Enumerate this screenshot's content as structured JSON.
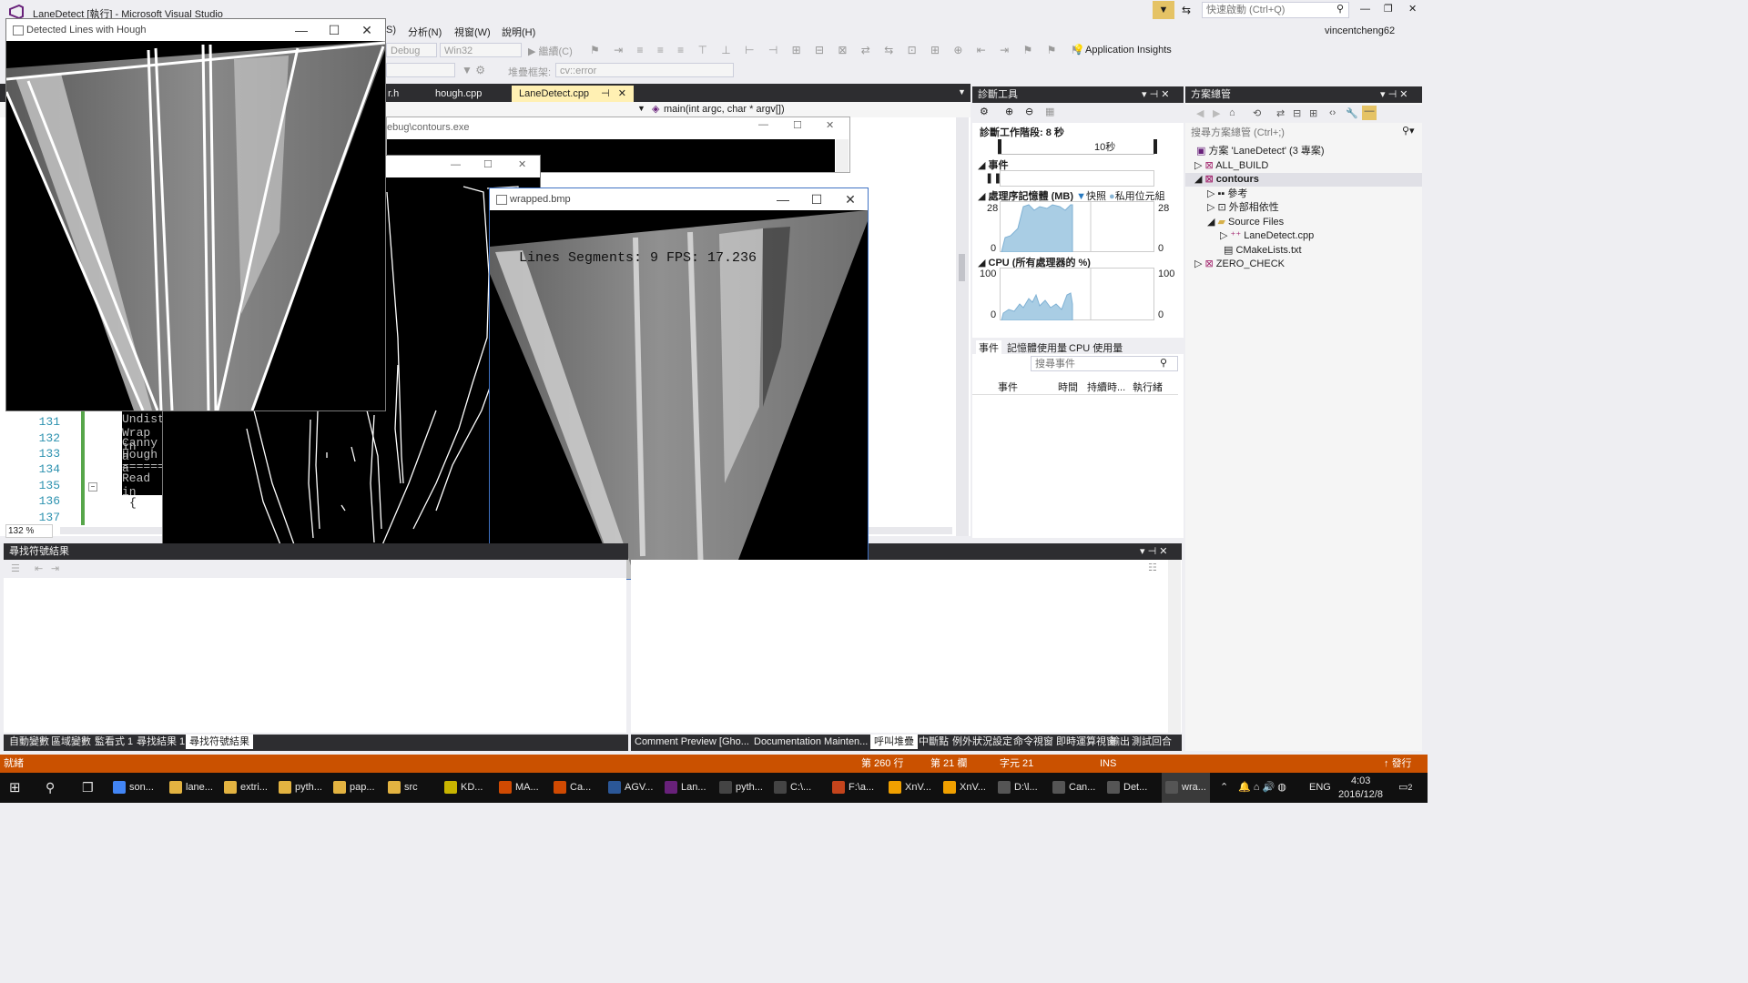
{
  "vs": {
    "title": "LaneDetect [執行] - Microsoft Visual Studio",
    "quick_launch_placeholder": "快速啟動 (Ctrl+Q)",
    "user": "vincentcheng62",
    "menu": [
      "S)",
      "分析(N)",
      "視窗(W)",
      "說明(H)"
    ],
    "toolbar": {
      "config": "Debug",
      "platform": "Win32",
      "continue": "繼續(C)",
      "app_insights": "Application Insights",
      "stack_label": "堆疊框架:",
      "stack_value": "cv::error"
    },
    "tabs": [
      {
        "label": "r.h"
      },
      {
        "label": "hough.cpp"
      },
      {
        "label": "LaneDetect.cpp"
      }
    ],
    "nav_member": "main(int argc, char * argv[])",
    "zoom": "132 %",
    "line_numbers": [
      "131",
      "132",
      "133",
      "134",
      "135",
      "136",
      "137"
    ],
    "console_lines": [
      "Undisto",
      "Wrap in",
      "Canny a",
      "Hough a",
      "=======",
      "Read in",
      "{"
    ]
  },
  "windows": {
    "hough": {
      "title": "Detected Lines with Hough"
    },
    "contours": {
      "title": "ebug\\contours.exe"
    },
    "wrapped": {
      "title": "wrapped.bmp",
      "overlay": "Lines Segments: 9 FPS: 17.236"
    }
  },
  "diag": {
    "title": "診斷工具",
    "session": "診斷工作階段: 8 秒",
    "timeline_label": "10秒",
    "events_header": "事件",
    "mem_header": "處理序記憶體 (MB)",
    "mem_legend_snapshot": "快照",
    "mem_legend_private": "私用位元組",
    "mem_max": "28",
    "mem_min": "0",
    "cpu_header": "CPU (所有處理器的 %)",
    "cpu_max": "100",
    "cpu_min": "0",
    "tabs": [
      "事件",
      "記憶體使用量",
      "CPU 使用量"
    ],
    "search_placeholder": "搜尋事件",
    "columns": [
      "事件",
      "時間",
      "持續時...",
      "執行緒"
    ]
  },
  "solution": {
    "title": "方案總管",
    "search_placeholder": "搜尋方案總管 (Ctrl+;)",
    "items": [
      {
        "label": "方案 'LaneDetect' (3 專案)"
      },
      {
        "label": "ALL_BUILD"
      },
      {
        "label": "contours"
      },
      {
        "label": "參考"
      },
      {
        "label": "外部相依性"
      },
      {
        "label": "Source Files"
      },
      {
        "label": "LaneDetect.cpp"
      },
      {
        "label": "CMakeLists.txt"
      },
      {
        "label": "ZERO_CHECK"
      }
    ]
  },
  "find_symbol": {
    "title": "尋找符號結果"
  },
  "bottom_left_tabs": [
    "自動變數",
    "區域變數",
    "監看式 1",
    "尋找結果 1",
    "尋找符號結果"
  ],
  "bottom_right_tabs": [
    "Comment Preview [Gho...",
    "Documentation Mainten...",
    "呼叫堆疊",
    "中斷點",
    "例外狀況設定",
    "命令視窗",
    "即時運算視窗",
    "輸出",
    "測試回合"
  ],
  "status": {
    "ready": "就緒",
    "line": "第 260 行",
    "col": "第 21 欄",
    "char": "字元 21",
    "ins": "INS",
    "publish": "發行"
  },
  "taskbar": {
    "items": [
      "son...",
      "lane...",
      "extri...",
      "pyth...",
      "pap...",
      "src",
      "KD...",
      "MA...",
      "Ca...",
      "AGV...",
      "Lan...",
      "pyth...",
      "C:\\...",
      "F:\\a...",
      "XnV...",
      "XnV...",
      "D:\\l...",
      "Can...",
      "Det...",
      "wra..."
    ],
    "lang": "ENG",
    "time": "4:03",
    "date": "2016/12/8",
    "notif": "2"
  },
  "colors": {
    "accent": "#ca5100",
    "dark": "#2d2d30",
    "tab_active": "#fff0b3",
    "line_no": "#2b91af",
    "chart_fill": "#a9cde4"
  }
}
